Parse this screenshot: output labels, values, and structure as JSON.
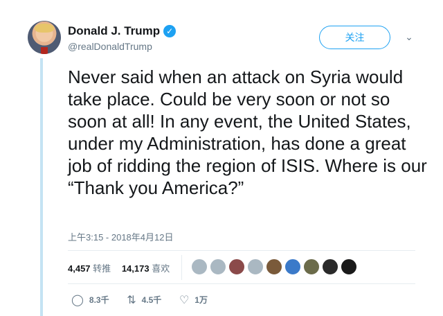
{
  "user": {
    "name": "Donald J. Trump",
    "handle": "@realDonaldTrump",
    "verified_icon": "verified-check-icon"
  },
  "follow_button": "关注",
  "tweet": {
    "text": "Never said when an attack on Syria would take place. Could be very soon or not so soon at all! In any event, the United States, under my Administration, has done a great job of ridding the region of ISIS. Where is our “Thank you America?”",
    "timestamp": "上午3:15 - 2018年4月12日"
  },
  "stats": {
    "retweets_count": "4,457",
    "retweets_label": "转推",
    "likes_count": "14,173",
    "likes_label": "喜欢"
  },
  "likers": [
    {
      "color": "#aab8c2"
    },
    {
      "color": "#aab8c2"
    },
    {
      "color": "#8b4a4a"
    },
    {
      "color": "#aab8c2"
    },
    {
      "color": "#7a5a3a"
    },
    {
      "color": "#3b7ac9"
    },
    {
      "color": "#6b6b4a"
    },
    {
      "color": "#2a2a2a"
    },
    {
      "color": "#1a1a1a"
    }
  ],
  "actions": {
    "reply_count": "8.3千",
    "retweet_count": "4.5千",
    "like_count": "1万"
  },
  "colors": {
    "accent": "#1da1f2",
    "thread_line": "#c4e3f3",
    "secondary_text": "#657786"
  }
}
